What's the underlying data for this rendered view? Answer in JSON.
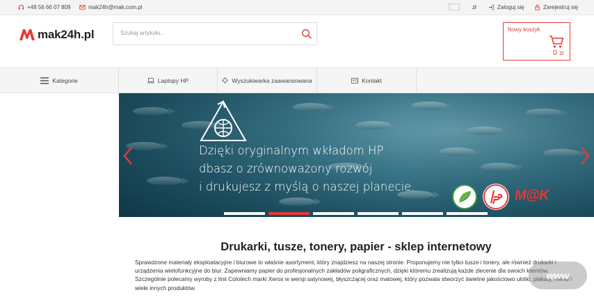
{
  "topbar": {
    "phone": "+48 56 66 07 809",
    "email": "mak24h@mak.com.pl",
    "currency": "zł",
    "login": "Zaloguj się",
    "register": "Zarejestruj się"
  },
  "header": {
    "logo_text": "mak24h.pl",
    "search_placeholder": "Szukaj artykułu...",
    "cart_label": "Nowy koszyk",
    "cart_amount": "0",
    "cart_currency": "zł"
  },
  "nav": {
    "categories": "Kategorie",
    "laptops": "Laptopy HP",
    "advanced_search": "Wyszukiwarka zaawansowana",
    "contact": "Kontakt"
  },
  "banner": {
    "line1": "Dzięki oryginalnym wkładom HP",
    "line2": "dbasz o zrównoważony rozwój",
    "line3": "i drukujesz z myślą o naszej planecie.",
    "brand": "M@K",
    "slides": 6,
    "active_slide": 2
  },
  "content": {
    "heading": "Drukarki, tusze, tonery, papier - sklep internetowy",
    "paragraph": "Sprawdzone materiały eksploatacyjne i biurowe to właśnie asortyment, który znajdziesz na naszej stronie. Proponujemy nie tylko tusze i tonery, ale również drukarki i urządzenia wielofunkcyjne do biur. Zapewniamy papier do profesjonalnych zakładów poligraficznych, dzięki któremu zrealizują każde zlecenie dla swoich klientów. Szczególnie polecamy wyroby z linii Colotech marki Xerox w wersji satynowej, błyszczącej oraz matowej, który pozwala stworzyć świetne jakościowo ulotki, plakaty, menu i wiele innych produktów."
  },
  "watermark": "www",
  "colors": {
    "accent": "#e53935"
  }
}
